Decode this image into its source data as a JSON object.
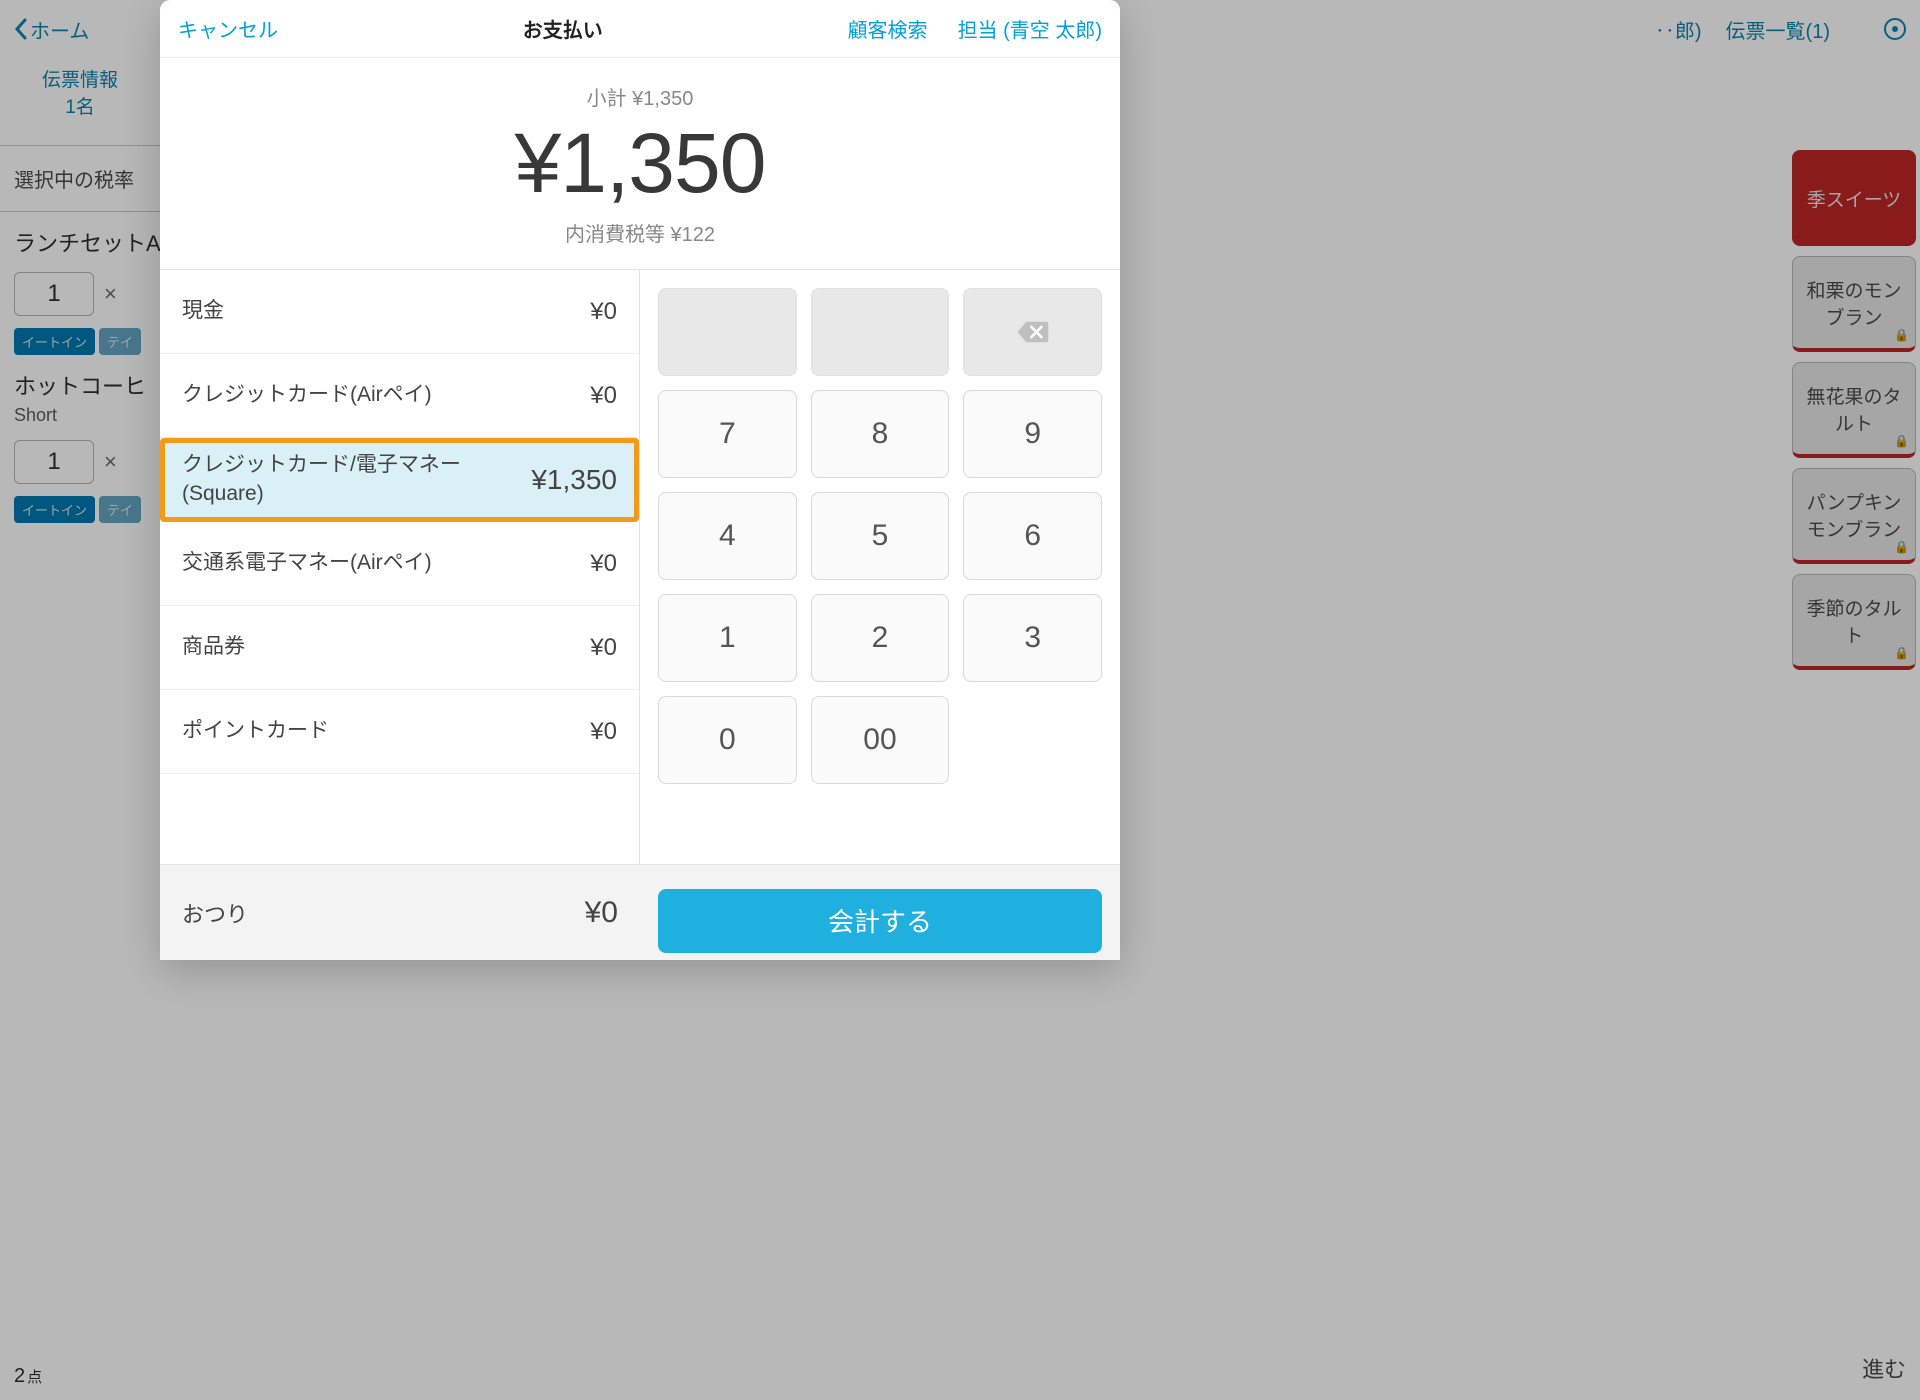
{
  "bg": {
    "home": "ホーム",
    "right_link1": "‥郎)",
    "right_link2": "伝票一覧(1)",
    "slip_info_l1": "伝票情報",
    "slip_info_l2": "1名",
    "tax_section": "選択中の税率",
    "item1_title": "ランチセットA",
    "item1_qty": "1",
    "item2_title": "ホットコーヒ",
    "item2_sub": "Short",
    "item2_qty": "1",
    "chip_eatin": "イートイン",
    "chip_take": "テイ",
    "tiles": [
      "季スイーツ",
      "和栗のモンブラン",
      "無花果のタルト",
      "パンプキンモンブラン",
      "季節のタルト"
    ],
    "bottom_count": "2",
    "bottom_unit": "点",
    "bottom_right": "進む"
  },
  "modal": {
    "cancel": "キャンセル",
    "title": "お支払い",
    "customer_search": "顧客検索",
    "staff": "担当 (青空 太郎)",
    "subtotal_label": "小計 ¥1,350",
    "grand_total": "¥1,350",
    "tax_included": "内消費税等 ¥122"
  },
  "methods": [
    {
      "name": "現金",
      "amount": "¥0",
      "selected": false
    },
    {
      "name": "クレジットカード(Airペイ)",
      "amount": "¥0",
      "selected": false
    },
    {
      "name": "クレジットカード/電子マネー(Square)",
      "amount": "¥1,350",
      "selected": true
    },
    {
      "name": "交通系電子マネー(Airペイ)",
      "amount": "¥0",
      "selected": false
    },
    {
      "name": "商品券",
      "amount": "¥0",
      "selected": false
    },
    {
      "name": "ポイントカード",
      "amount": "¥0",
      "selected": false
    }
  ],
  "keypad": {
    "keys": [
      "",
      "",
      "backspace",
      "7",
      "8",
      "9",
      "4",
      "5",
      "6",
      "1",
      "2",
      "3",
      "0",
      "00"
    ]
  },
  "footer": {
    "change_label": "おつり",
    "change_amount": "¥0",
    "checkout": "会計する"
  }
}
